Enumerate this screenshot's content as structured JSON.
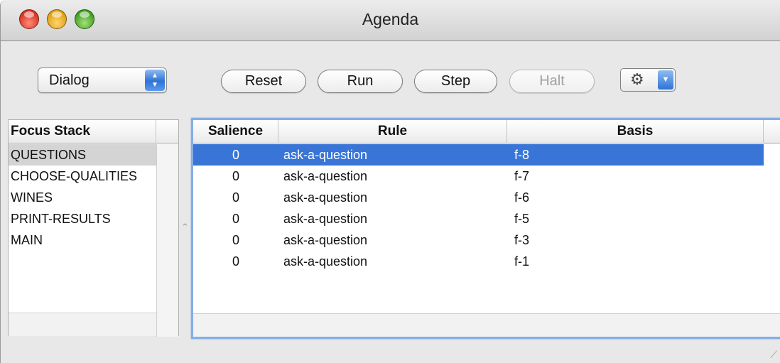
{
  "window": {
    "title": "Agenda"
  },
  "toolbar": {
    "module_select": {
      "value": "Dialog"
    },
    "reset_label": "Reset",
    "run_label": "Run",
    "step_label": "Step",
    "halt_label": "Halt",
    "halt_enabled": false,
    "gear_icon": "gear-icon"
  },
  "focus_stack": {
    "header": "Focus Stack",
    "items": [
      "QUESTIONS",
      "CHOOSE-QUALITIES",
      "WINES",
      "PRINT-RESULTS",
      "MAIN"
    ],
    "selected_index": 0
  },
  "agenda": {
    "columns": [
      "Salience",
      "Rule",
      "Basis"
    ],
    "rows": [
      {
        "salience": "0",
        "rule": "ask-a-question",
        "basis": "f-8"
      },
      {
        "salience": "0",
        "rule": "ask-a-question",
        "basis": "f-7"
      },
      {
        "salience": "0",
        "rule": "ask-a-question",
        "basis": "f-6"
      },
      {
        "salience": "0",
        "rule": "ask-a-question",
        "basis": "f-5"
      },
      {
        "salience": "0",
        "rule": "ask-a-question",
        "basis": "f-3"
      },
      {
        "salience": "0",
        "rule": "ask-a-question",
        "basis": "f-1"
      }
    ],
    "selected_index": 0
  },
  "colors": {
    "selection": "#3875d7",
    "focus_ring": "#86aee6",
    "inactive_selection": "#d4d4d4"
  }
}
